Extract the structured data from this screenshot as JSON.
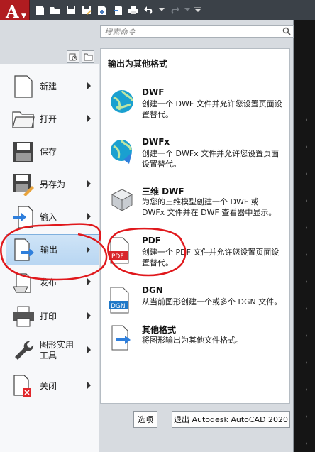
{
  "app": {
    "logo_letter": "A"
  },
  "search": {
    "placeholder": "搜索命令"
  },
  "sidebar": {
    "items": [
      {
        "label": "新建"
      },
      {
        "label": "打开"
      },
      {
        "label": "保存"
      },
      {
        "label": "另存为"
      },
      {
        "label": "输入"
      },
      {
        "label": "输出"
      },
      {
        "label": "发布"
      },
      {
        "label": "打印"
      },
      {
        "label": "图形实用工具"
      },
      {
        "label": "关闭"
      }
    ]
  },
  "panel": {
    "title": "输出为其他格式",
    "entries": [
      {
        "title": "DWF",
        "desc": "创建一个 DWF 文件并允许您设置页面设置替代。"
      },
      {
        "title": "DWFx",
        "desc": "创建一个 DWFx 文件并允许您设置页面设置替代。"
      },
      {
        "title": "三维 DWF",
        "desc": "为您的三维模型创建一个 DWF 或 DWFx 文件并在 DWF 查看器中显示。"
      },
      {
        "title": "PDF",
        "desc": "创建一个 PDF 文件并允许您设置页面设置替代。",
        "icon_text": "PDF"
      },
      {
        "title": "DGN",
        "desc": "从当前图形创建一个或多个 DGN 文件。",
        "icon_text": "DGN"
      },
      {
        "title": "其他格式",
        "desc": "将图形输出为其他文件格式。"
      }
    ]
  },
  "footer": {
    "options_label": "选项",
    "exit_label": "退出 Autodesk AutoCAD 2020"
  },
  "colors": {
    "brand_red": "#b01c20",
    "highlight_blue": "#b8d6f2",
    "annotation_red": "#e0181c"
  }
}
